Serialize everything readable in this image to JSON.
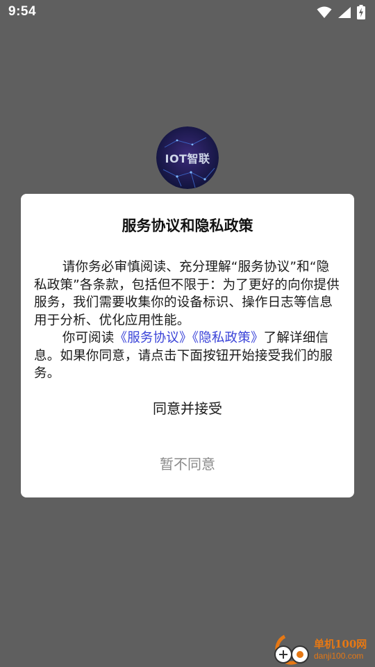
{
  "status_bar": {
    "time": "9:54",
    "icons": [
      "wifi-icon",
      "signal-icon",
      "battery-charging-icon"
    ]
  },
  "app": {
    "logo_text": "IOT智联"
  },
  "dialog": {
    "title": "服务协议和隐私政策",
    "paragraph1": "请你务必审慎阅读、充分理解“服务协议”和“隐私政策”各条款，包括但不限于：为了更好的向你提供服务，我们需要收集你的设备标识、操作日志等信息用于分析、优化应用性能。",
    "paragraph2_prefix": "你可阅读",
    "link_service": "《服务协议》",
    "link_privacy": "《隐私政策》",
    "paragraph2_suffix": "了解详细信息。如果你同意，请点击下面按钮开始接受我们的服务。",
    "agree_label": "同意并接受",
    "disagree_label": "暂不同意"
  },
  "watermark": {
    "title": "单机100网",
    "url": "danji100.com"
  },
  "colors": {
    "overlay": "#5f5f5f",
    "link": "#3a43d8",
    "watermark": "#e67814"
  }
}
